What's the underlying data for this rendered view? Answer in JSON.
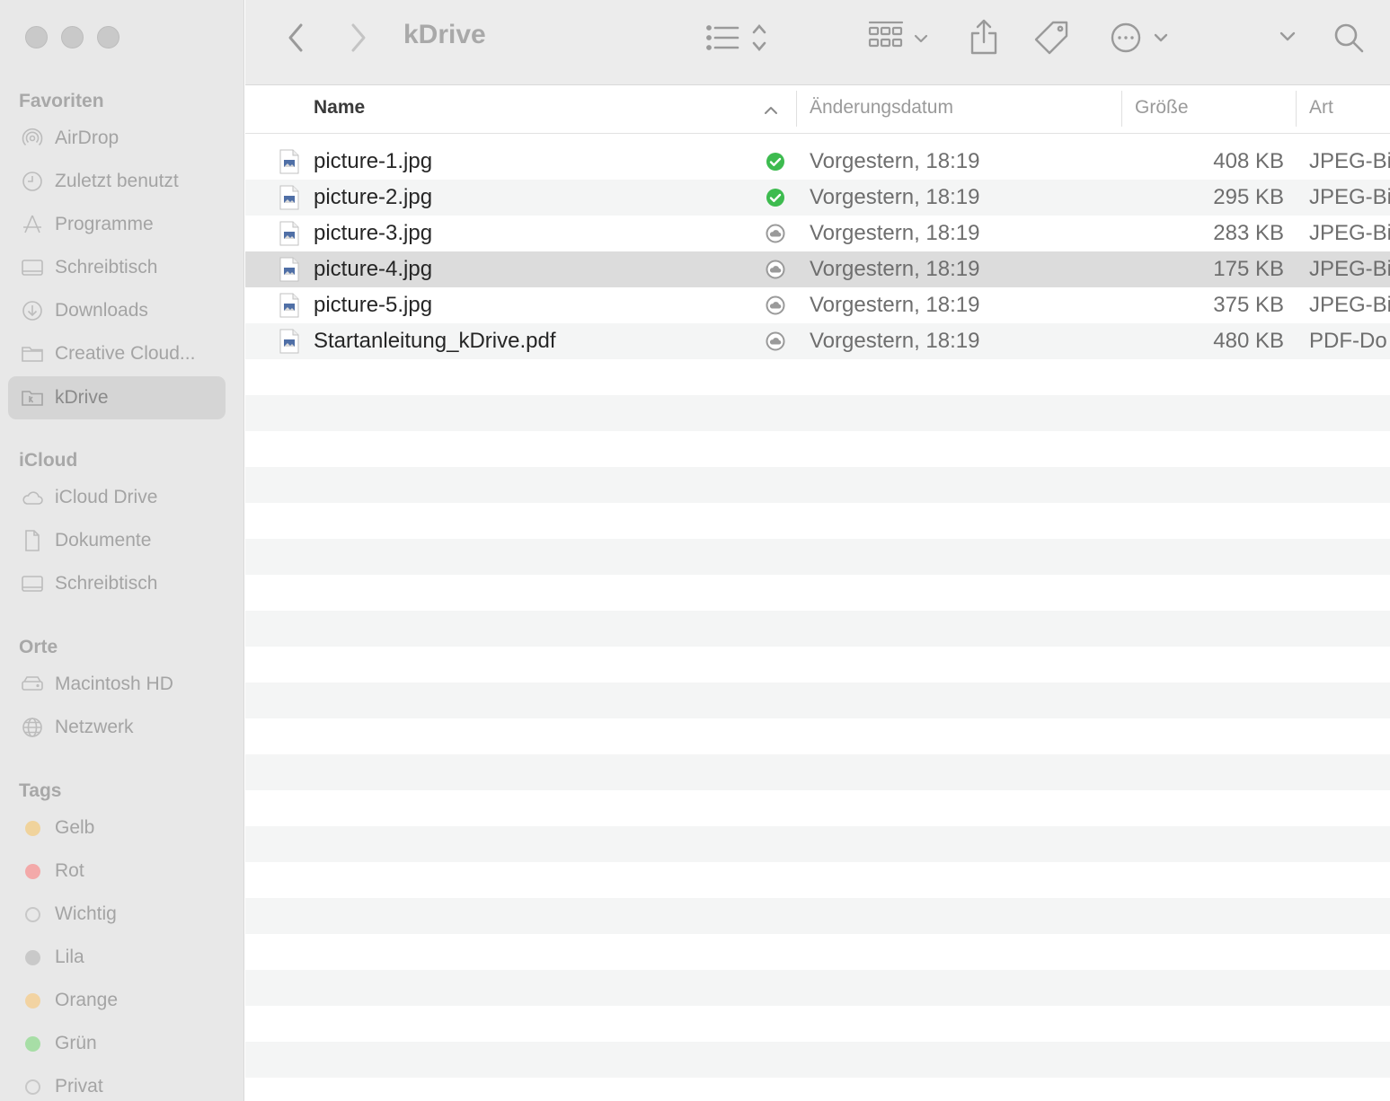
{
  "window": {
    "title": "kDrive"
  },
  "sidebar": {
    "sections": [
      {
        "title": "Favoriten",
        "items": [
          {
            "label": "AirDrop",
            "icon": "airdrop-icon"
          },
          {
            "label": "Zuletzt benutzt",
            "icon": "clock-icon"
          },
          {
            "label": "Programme",
            "icon": "apps-icon"
          },
          {
            "label": "Schreibtisch",
            "icon": "desktop-icon"
          },
          {
            "label": "Downloads",
            "icon": "download-icon"
          },
          {
            "label": "Creative Cloud...",
            "icon": "folder-icon"
          },
          {
            "label": "kDrive",
            "icon": "kdrive-folder-icon",
            "selected": true
          }
        ]
      },
      {
        "title": "iCloud",
        "items": [
          {
            "label": "iCloud Drive",
            "icon": "cloud-icon"
          },
          {
            "label": "Dokumente",
            "icon": "document-icon"
          },
          {
            "label": "Schreibtisch",
            "icon": "desktop-icon"
          }
        ]
      },
      {
        "title": "Orte",
        "items": [
          {
            "label": "Macintosh HD",
            "icon": "harddisk-icon"
          },
          {
            "label": "Netzwerk",
            "icon": "globe-icon"
          }
        ]
      },
      {
        "title": "Tags",
        "items": [
          {
            "label": "Gelb",
            "color": "#f0d39c"
          },
          {
            "label": "Rot",
            "color": "#f3a9a9"
          },
          {
            "label": "Wichtig",
            "color": "hollow"
          },
          {
            "label": "Lila",
            "color": "#c9c9c9"
          },
          {
            "label": "Orange",
            "color": "#f2d3a2"
          },
          {
            "label": "Grün",
            "color": "#a7dea6"
          },
          {
            "label": "Privat",
            "color": "hollow"
          }
        ]
      }
    ]
  },
  "columns": {
    "name": "Name",
    "date": "Änderungsdatum",
    "size": "Größe",
    "kind": "Art"
  },
  "files": [
    {
      "name": "picture-1.jpg",
      "status": "synced",
      "date": "Vorgestern, 18:19",
      "size": "408 KB",
      "kind": "JPEG-Bi"
    },
    {
      "name": "picture-2.jpg",
      "status": "synced",
      "date": "Vorgestern, 18:19",
      "size": "295 KB",
      "kind": "JPEG-Bi"
    },
    {
      "name": "picture-3.jpg",
      "status": "cloud",
      "date": "Vorgestern, 18:19",
      "size": "283 KB",
      "kind": "JPEG-Bi"
    },
    {
      "name": "picture-4.jpg",
      "status": "cloud",
      "date": "Vorgestern, 18:19",
      "size": "175 KB",
      "kind": "JPEG-Bi",
      "selected": true
    },
    {
      "name": "picture-5.jpg",
      "status": "cloud",
      "date": "Vorgestern, 18:19",
      "size": "375 KB",
      "kind": "JPEG-Bi"
    },
    {
      "name": "Startanleitung_kDrive.pdf",
      "status": "cloud",
      "date": "Vorgestern, 18:19",
      "size": "480 KB",
      "kind": "PDF-Do"
    }
  ],
  "colors": {
    "synced": "#3dbb4f",
    "cloud": "#9a9a9a",
    "selected_row": "#dcdcdc"
  }
}
